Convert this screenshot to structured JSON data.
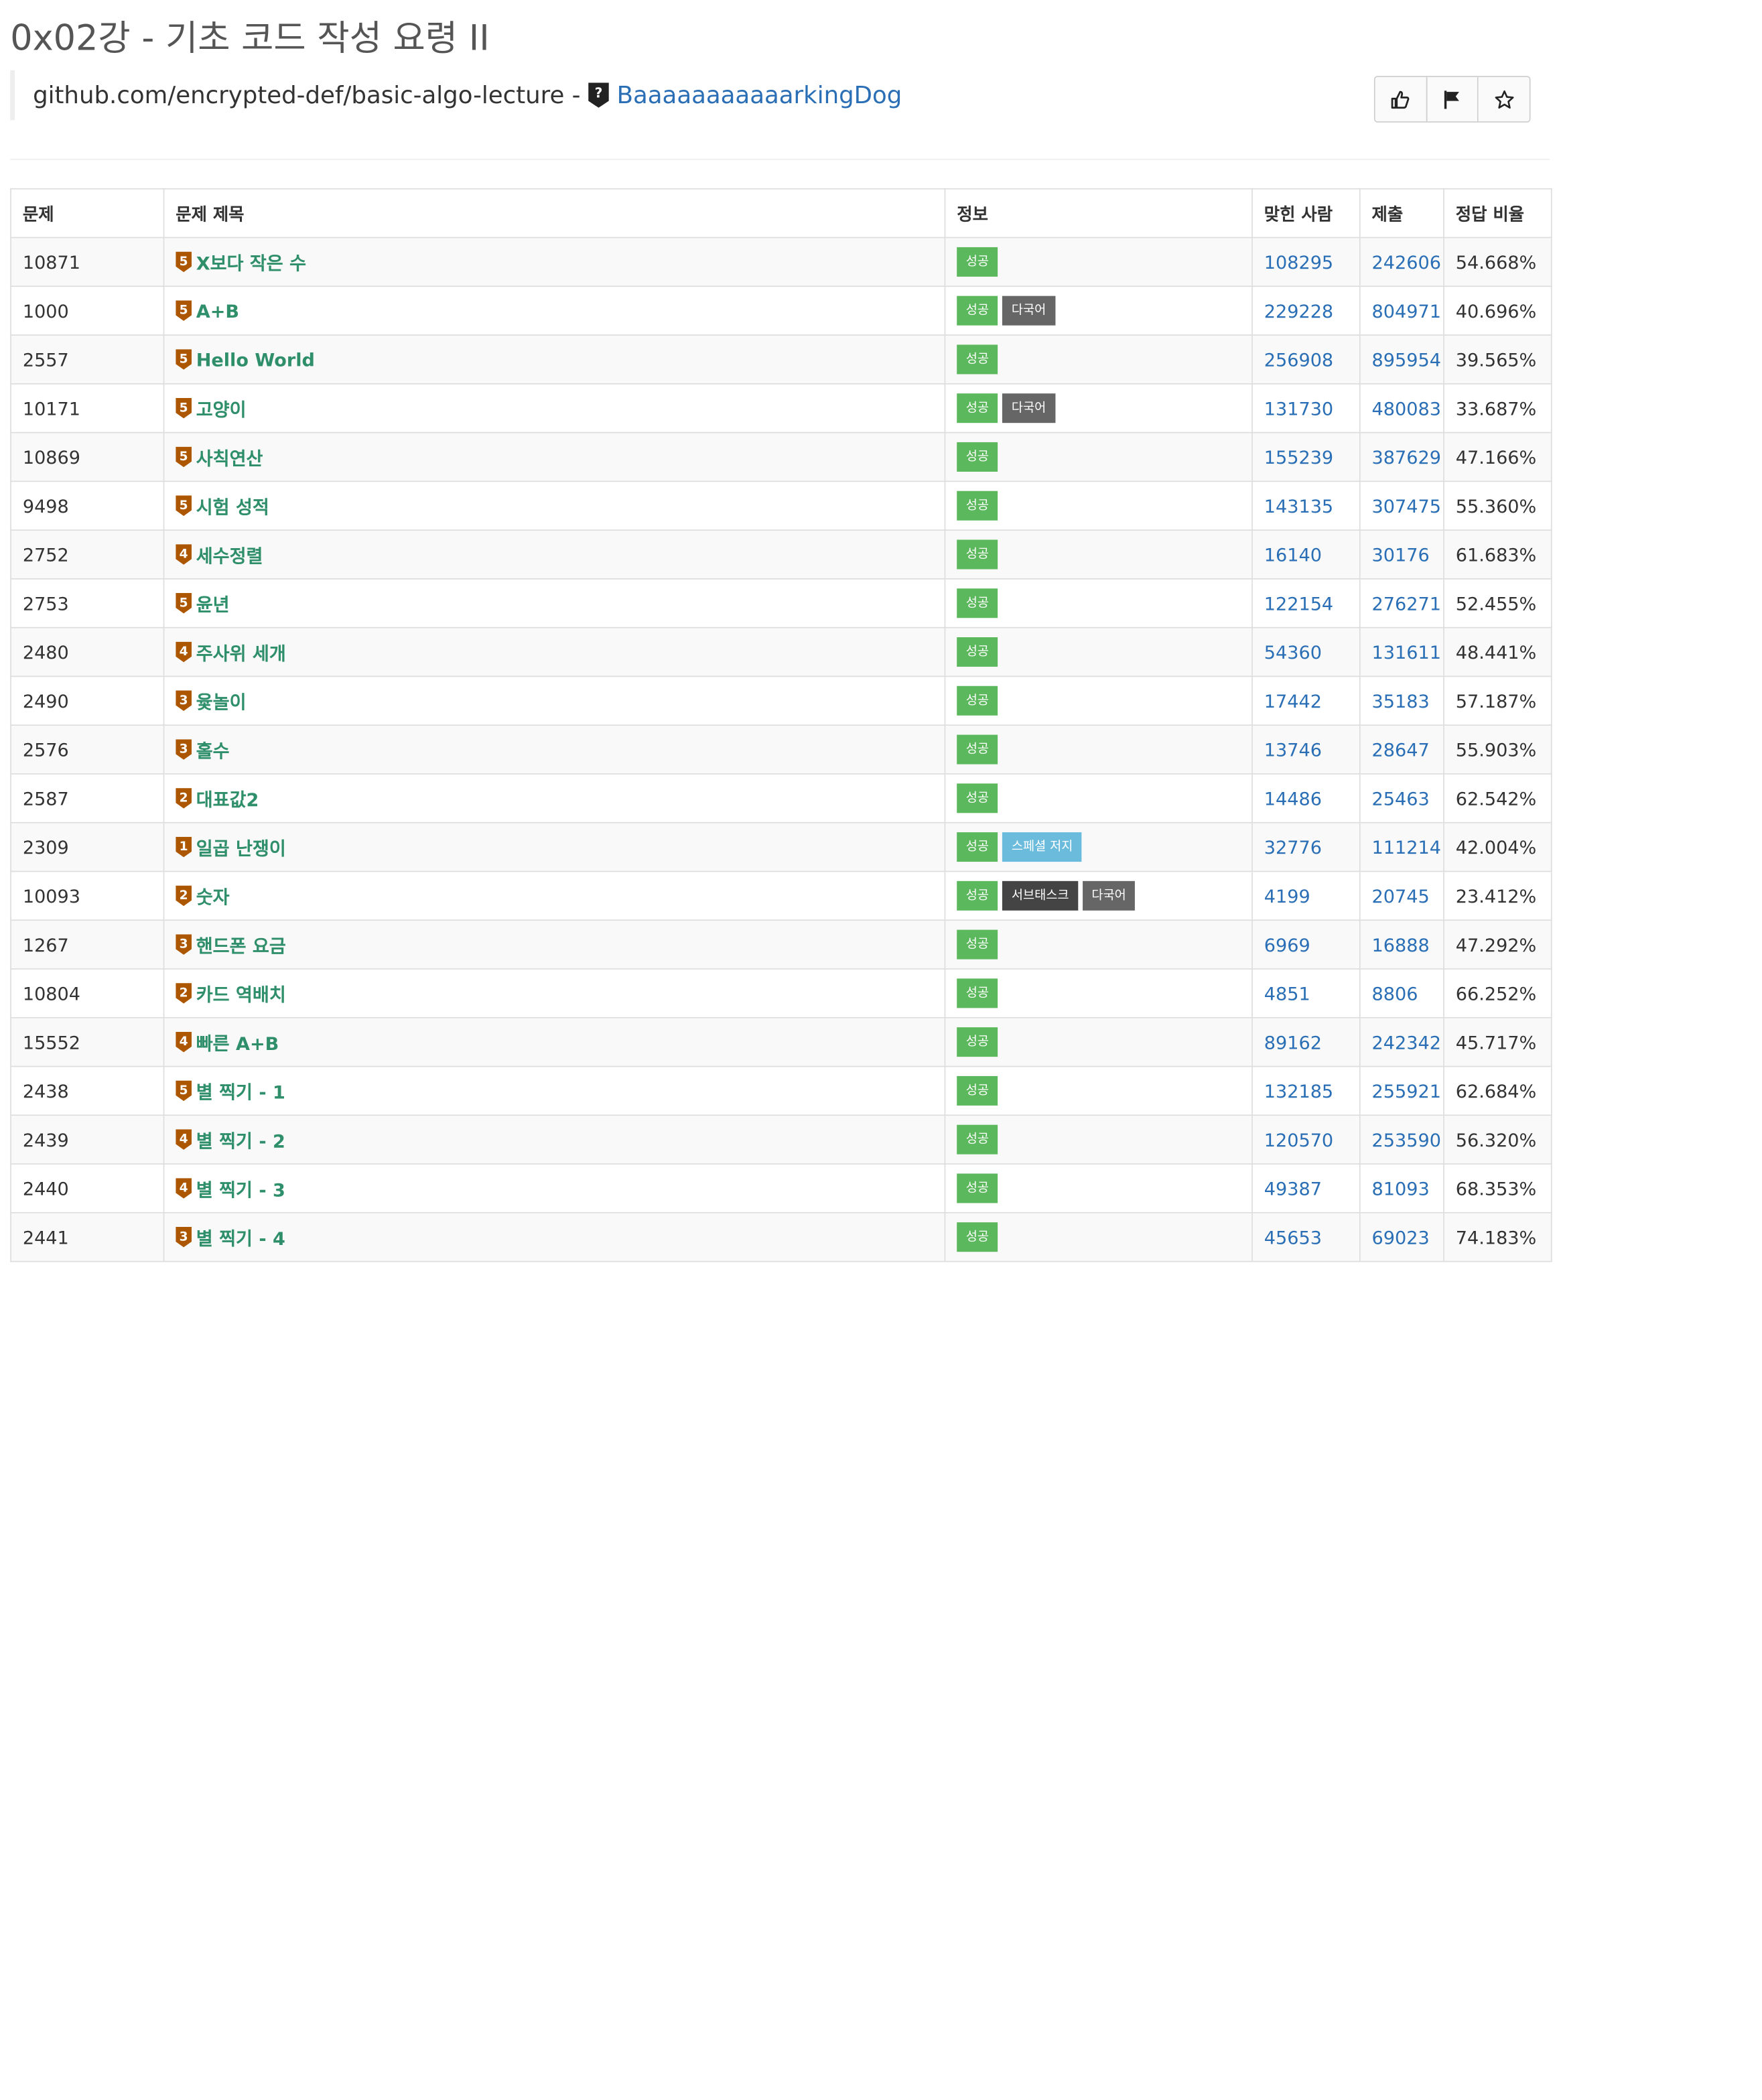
{
  "header": {
    "title": "0x02강 - 기초 코드 작성 요령 II",
    "source_text": "github.com/encrypted-def/basic-algo-lecture - ",
    "author": "BaaaaaaaaaaarkingDog",
    "author_rank_icon": "question-badge-icon"
  },
  "actions": {
    "like_icon": "thumbs-up-icon",
    "report_icon": "flag-icon",
    "favorite_icon": "star-icon"
  },
  "table": {
    "headers": [
      "문제",
      "문제 제목",
      "정보",
      "맞힌 사람",
      "제출",
      "정답 비율"
    ],
    "rows": [
      {
        "id": "10871",
        "tier": "5",
        "title": "X보다 작은 수",
        "labels": [
          "성공"
        ],
        "solved": "108295",
        "submissions": "242606",
        "ratio": "54.668%"
      },
      {
        "id": "1000",
        "tier": "5",
        "title": "A+B",
        "labels": [
          "성공",
          "다국어"
        ],
        "solved": "229228",
        "submissions": "804971",
        "ratio": "40.696%"
      },
      {
        "id": "2557",
        "tier": "5",
        "title": "Hello World",
        "labels": [
          "성공"
        ],
        "solved": "256908",
        "submissions": "895954",
        "ratio": "39.565%"
      },
      {
        "id": "10171",
        "tier": "5",
        "title": "고양이",
        "labels": [
          "성공",
          "다국어"
        ],
        "solved": "131730",
        "submissions": "480083",
        "ratio": "33.687%"
      },
      {
        "id": "10869",
        "tier": "5",
        "title": "사칙연산",
        "labels": [
          "성공"
        ],
        "solved": "155239",
        "submissions": "387629",
        "ratio": "47.166%"
      },
      {
        "id": "9498",
        "tier": "5",
        "title": "시험 성적",
        "labels": [
          "성공"
        ],
        "solved": "143135",
        "submissions": "307475",
        "ratio": "55.360%"
      },
      {
        "id": "2752",
        "tier": "4",
        "title": "세수정렬",
        "labels": [
          "성공"
        ],
        "solved": "16140",
        "submissions": "30176",
        "ratio": "61.683%"
      },
      {
        "id": "2753",
        "tier": "5",
        "title": "윤년",
        "labels": [
          "성공"
        ],
        "solved": "122154",
        "submissions": "276271",
        "ratio": "52.455%"
      },
      {
        "id": "2480",
        "tier": "4",
        "title": "주사위 세개",
        "labels": [
          "성공"
        ],
        "solved": "54360",
        "submissions": "131611",
        "ratio": "48.441%"
      },
      {
        "id": "2490",
        "tier": "3",
        "title": "윷놀이",
        "labels": [
          "성공"
        ],
        "solved": "17442",
        "submissions": "35183",
        "ratio": "57.187%"
      },
      {
        "id": "2576",
        "tier": "3",
        "title": "홀수",
        "labels": [
          "성공"
        ],
        "solved": "13746",
        "submissions": "28647",
        "ratio": "55.903%"
      },
      {
        "id": "2587",
        "tier": "2",
        "title": "대표값2",
        "labels": [
          "성공"
        ],
        "solved": "14486",
        "submissions": "25463",
        "ratio": "62.542%"
      },
      {
        "id": "2309",
        "tier": "1",
        "title": "일곱 난쟁이",
        "labels": [
          "성공",
          "스페셜 저지"
        ],
        "solved": "32776",
        "submissions": "111214",
        "ratio": "42.004%"
      },
      {
        "id": "10093",
        "tier": "2",
        "title": "숫자",
        "labels": [
          "성공",
          "서브태스크",
          "다국어"
        ],
        "solved": "4199",
        "submissions": "20745",
        "ratio": "23.412%"
      },
      {
        "id": "1267",
        "tier": "3",
        "title": "핸드폰 요금",
        "labels": [
          "성공"
        ],
        "solved": "6969",
        "submissions": "16888",
        "ratio": "47.292%"
      },
      {
        "id": "10804",
        "tier": "2",
        "title": "카드 역배치",
        "labels": [
          "성공"
        ],
        "solved": "4851",
        "submissions": "8806",
        "ratio": "66.252%"
      },
      {
        "id": "15552",
        "tier": "4",
        "title": "빠른 A+B",
        "labels": [
          "성공"
        ],
        "solved": "89162",
        "submissions": "242342",
        "ratio": "45.717%"
      },
      {
        "id": "2438",
        "tier": "5",
        "title": "별 찍기 - 1",
        "labels": [
          "성공"
        ],
        "solved": "132185",
        "submissions": "255921",
        "ratio": "62.684%"
      },
      {
        "id": "2439",
        "tier": "4",
        "title": "별 찍기 - 2",
        "labels": [
          "성공"
        ],
        "solved": "120570",
        "submissions": "253590",
        "ratio": "56.320%"
      },
      {
        "id": "2440",
        "tier": "4",
        "title": "별 찍기 - 3",
        "labels": [
          "성공"
        ],
        "solved": "49387",
        "submissions": "81093",
        "ratio": "68.353%"
      },
      {
        "id": "2441",
        "tier": "3",
        "title": "별 찍기 - 4",
        "labels": [
          "성공"
        ],
        "solved": "45653",
        "submissions": "69023",
        "ratio": "74.183%"
      }
    ]
  },
  "colors": {
    "title_link": "#2f8f6a",
    "number_link": "#2a6fb5",
    "bronze_tier": "#ad5600",
    "label_success": "#5cb85c",
    "label_multilang": "#666666",
    "label_subtask": "#444444",
    "label_special": "#6bbcdc"
  }
}
